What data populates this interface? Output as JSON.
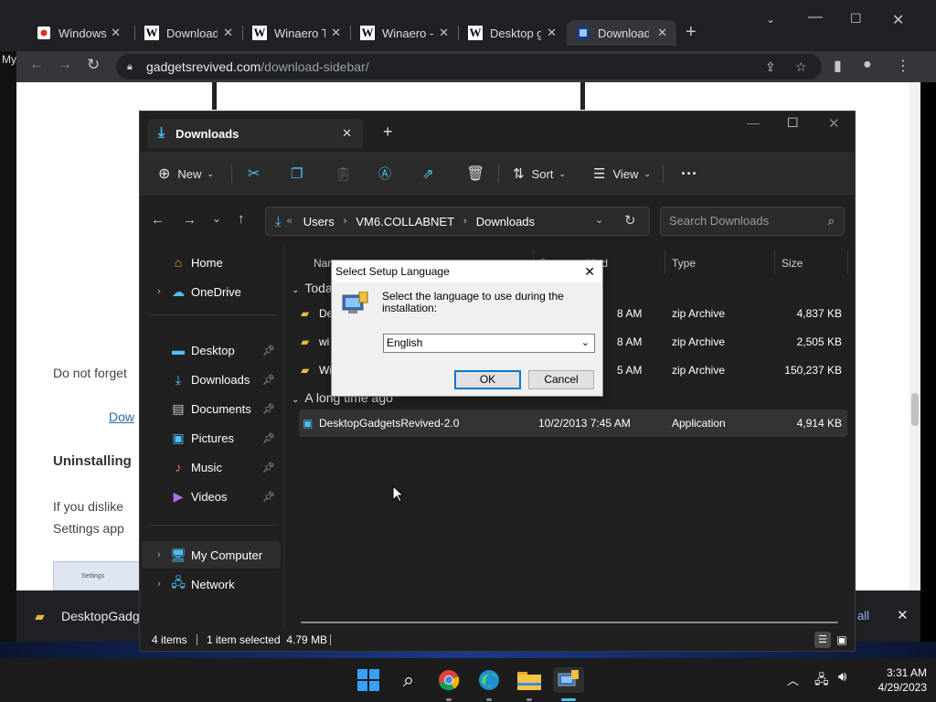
{
  "browser": {
    "tabs": [
      {
        "title": "Windows",
        "icon": "google-favicon"
      },
      {
        "title": "Download",
        "icon": "winaero-favicon"
      },
      {
        "title": "Winaero T",
        "icon": "winaero-favicon"
      },
      {
        "title": "Winaero -",
        "icon": "winaero-favicon"
      },
      {
        "title": "Desktop g",
        "icon": "winaero-favicon"
      },
      {
        "title": "Download",
        "icon": "gadgets-favicon"
      }
    ],
    "url_domain": "gadgetsrevived.com",
    "url_path": "/download-sidebar/",
    "side_label": "My"
  },
  "webpage": {
    "text1": "Do not forget",
    "link1": "Dow",
    "heading": "Uninstalling",
    "text2": "If you dislike",
    "text3": "Settings app",
    "thumb_label": "Settings",
    "download_bar_file": "DesktopGadge",
    "download_bar_show_all": "all"
  },
  "explorer": {
    "tab_title": "Downloads",
    "toolbar": {
      "new": "New",
      "sort": "Sort",
      "view": "View"
    },
    "breadcrumb": [
      "Users",
      "VM6.COLLABNET",
      "Downloads"
    ],
    "search_placeholder": "Search Downloads",
    "sidebar": {
      "home": "Home",
      "onedrive": "OneDrive",
      "desktop": "Desktop",
      "downloads": "Downloads",
      "documents": "Documents",
      "pictures": "Pictures",
      "music": "Music",
      "videos": "Videos",
      "my_computer": "My Computer",
      "network": "Network"
    },
    "columns": {
      "name": "Name",
      "date": "Date modified",
      "type": "Type",
      "size": "Size"
    },
    "groups": {
      "today": "Toda",
      "long_ago": "A long time ago"
    },
    "files": [
      {
        "name": "De",
        "date": "8 AM",
        "type": "zip Archive",
        "size": "4,837 KB"
      },
      {
        "name": "wi",
        "date": "8 AM",
        "type": "zip Archive",
        "size": "2,505 KB"
      },
      {
        "name": "Wi",
        "date": "5 AM",
        "type": "zip Archive",
        "size": "150,237 KB"
      },
      {
        "name": "DesktopGadgetsRevived-2.0",
        "date": "10/2/2013 7:45 AM",
        "type": "Application",
        "size": "4,914 KB"
      }
    ],
    "status": {
      "items": "4 items",
      "selected": "1 item selected  4.79 MB"
    }
  },
  "dialog": {
    "title": "Select Setup Language",
    "message": "Select the language to use during the installation:",
    "language": "English",
    "ok": "OK",
    "cancel": "Cancel"
  },
  "taskbar": {
    "time": "3:31 AM",
    "date": "4/29/2023"
  },
  "colors": {
    "accent": "#0078d4",
    "folder": "#e8b93e",
    "chrome_bg": "#202124"
  }
}
